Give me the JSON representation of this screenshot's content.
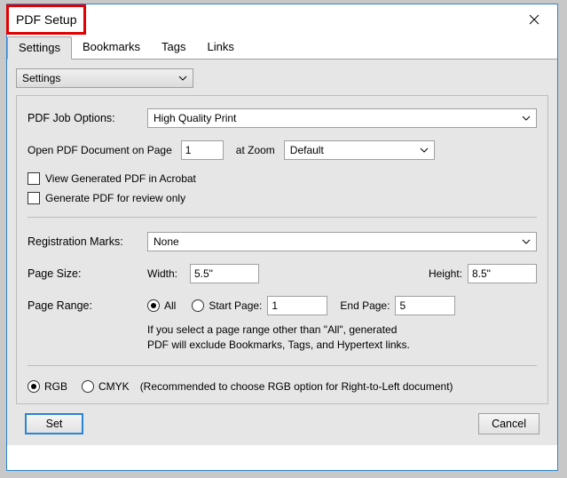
{
  "window": {
    "title": "PDF Setup"
  },
  "tabs": [
    "Settings",
    "Bookmarks",
    "Tags",
    "Links"
  ],
  "activeTab": 0,
  "settingsDropdown": {
    "value": "Settings"
  },
  "labels": {
    "jobOptions": "PDF Job Options:",
    "openOn": "Open PDF Document on Page",
    "atZoom": "at Zoom",
    "viewInAcrobat": "View Generated PDF in Acrobat",
    "reviewOnly": "Generate PDF for review only",
    "regMarks": "Registration Marks:",
    "pageSize": "Page Size:",
    "width": "Width:",
    "height": "Height:",
    "pageRange": "Page Range:",
    "all": "All",
    "startPage": "Start Page:",
    "endPage": "End Page:",
    "note1": "If you select a page range other than \"All\",  generated",
    "note2": "PDF will exclude Bookmarks, Tags, and Hypertext links.",
    "rgb": "RGB",
    "cmyk": "CMYK",
    "colorNote": "(Recommended to choose RGB option for Right-to-Left document)"
  },
  "values": {
    "jobOptions": "High Quality Print",
    "openPage": "1",
    "zoom": "Default",
    "viewInAcrobat": false,
    "reviewOnly": false,
    "regMarks": "None",
    "width": "5.5\"",
    "height": "8.5\"",
    "rangeAll": true,
    "startPage": "1",
    "endPage": "5",
    "colorMode": "RGB"
  },
  "buttons": {
    "set": "Set",
    "cancel": "Cancel"
  }
}
